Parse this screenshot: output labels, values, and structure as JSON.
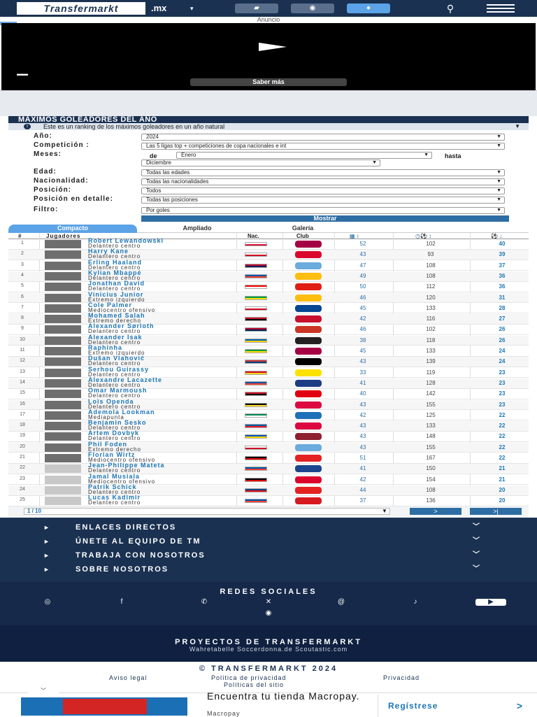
{
  "header": {
    "logo_text": "Transfermarkt",
    "domain": ".mx",
    "nav_icons": [
      "bookmark-icon",
      "ball-icon",
      "user-icon"
    ],
    "colors": {
      "bar": "#1a3151",
      "active": "#5ba3e6"
    }
  },
  "ad": {
    "label": "Anuncio",
    "cta": "Saber más"
  },
  "section": {
    "title": "MÁXIMOS GOLEADORES DEL AÑO",
    "info": "Este es un ranking de los máximos goleadores en un año natural",
    "filters": {
      "year_label": "Año:",
      "year_value": "2024",
      "competition_label": "Competición :",
      "competition_value": "Las 5 ligas top + competiciones de copa nacionales e int",
      "months_label": "Meses:",
      "months_from_prefix": "de",
      "months_from": "Enero",
      "months_to_label": "hasta",
      "months_to": "Diciembre",
      "age_label": "Edad:",
      "age_value": "Todas las edades",
      "nationality_label": "Nacionalidad:",
      "nationality_value": "Todas las nacionalidades",
      "position_label": "Posición:",
      "position_value": "Todos",
      "detail_position_label": "Posición en detalle:",
      "detail_position_value": "Todas las posiciones",
      "filter_label": "Filtro:",
      "filter_value": "Por goles",
      "submit": "Mostrar"
    },
    "tabs": [
      "Compacto",
      "Ampliado",
      "Galería"
    ],
    "columns": {
      "rank": "#",
      "players": "Jugadores",
      "nationality": "Nac.",
      "club": "Club"
    },
    "players": [
      {
        "rank": "1",
        "name": "Robert Lewandowski",
        "position": "Delantero centro",
        "apps": "52",
        "mins": "102",
        "goals": "40",
        "flag": [
          "#fff",
          "#dc143c"
        ],
        "crest": "#a50044"
      },
      {
        "rank": "2",
        "name": "Harry Kane",
        "position": "Delantero centro",
        "apps": "43",
        "mins": "93",
        "goals": "39",
        "flag": [
          "#fff",
          "#ce1124"
        ],
        "crest": "#dc052d"
      },
      {
        "rank": "3",
        "name": "Erling Haaland",
        "position": "Delantero centro",
        "apps": "47",
        "mins": "108",
        "goals": "37",
        "flag": [
          "#ba0c2f",
          "#00205b"
        ],
        "crest": "#6cabdd"
      },
      {
        "rank": "4",
        "name": "Kylian Mbappé",
        "position": "Delantero centro",
        "apps": "49",
        "mins": "108",
        "goals": "36",
        "flag": [
          "#0055a4",
          "#ef4135"
        ],
        "crest": "#febe10"
      },
      {
        "rank": "5",
        "name": "Jonathan David",
        "position": "Delantero centro",
        "apps": "50",
        "mins": "112",
        "goals": "36",
        "flag": [
          "#ff0000",
          "#fff"
        ],
        "crest": "#e01e13"
      },
      {
        "rank": "6",
        "name": "Vinicius Junior",
        "position": "Extremo izquierdo",
        "apps": "46",
        "mins": "120",
        "goals": "31",
        "flag": [
          "#009c3b",
          "#ffdf00"
        ],
        "crest": "#febe10"
      },
      {
        "rank": "7",
        "name": "Cole Palmer",
        "position": "Mediocentro ofensivo",
        "apps": "45",
        "mins": "133",
        "goals": "28",
        "flag": [
          "#fff",
          "#ce1124"
        ],
        "crest": "#034694"
      },
      {
        "rank": "8",
        "name": "Mohamed Salah",
        "position": "Extremo derecho",
        "apps": "42",
        "mins": "116",
        "goals": "27",
        "flag": [
          "#ce1126",
          "#000"
        ],
        "crest": "#c8102e"
      },
      {
        "rank": "9",
        "name": "Alexander Sørloth",
        "position": "Delantero centro",
        "apps": "46",
        "mins": "102",
        "goals": "26",
        "flag": [
          "#ba0c2f",
          "#00205b"
        ],
        "crest": "#cb3524"
      },
      {
        "rank": "10",
        "name": "Alexander Isak",
        "position": "Delantero centro",
        "apps": "38",
        "mins": "118",
        "goals": "26",
        "flag": [
          "#006aa7",
          "#fecc00"
        ],
        "crest": "#241f20"
      },
      {
        "rank": "11",
        "name": "Raphinha",
        "position": "Extremo izquierdo",
        "apps": "45",
        "mins": "133",
        "goals": "24",
        "flag": [
          "#009c3b",
          "#ffdf00"
        ],
        "crest": "#a50044"
      },
      {
        "rank": "12",
        "name": "Dušan Vlahović",
        "position": "Delantero centro",
        "apps": "43",
        "mins": "139",
        "goals": "24",
        "flag": [
          "#c6363c",
          "#0c4076"
        ],
        "crest": "#000000"
      },
      {
        "rank": "13",
        "name": "Serhou Guirassy",
        "position": "Delantero centro",
        "apps": "33",
        "mins": "119",
        "goals": "23",
        "flag": [
          "#ce1126",
          "#fcd116"
        ],
        "crest": "#fde100"
      },
      {
        "rank": "14",
        "name": "Alexandre Lacazette",
        "position": "Delantero centro",
        "apps": "41",
        "mins": "128",
        "goals": "23",
        "flag": [
          "#0055a4",
          "#ef4135"
        ],
        "crest": "#1c3c85"
      },
      {
        "rank": "15",
        "name": "Omar Marmoush",
        "position": "Delantero centro",
        "apps": "40",
        "mins": "142",
        "goals": "23",
        "flag": [
          "#ce1126",
          "#000"
        ],
        "crest": "#e1000f"
      },
      {
        "rank": "16",
        "name": "Loïs Openda",
        "position": "Delantero centro",
        "apps": "43",
        "mins": "155",
        "goals": "23",
        "flag": [
          "#000",
          "#fdda24"
        ],
        "crest": "#dd0741"
      },
      {
        "rank": "17",
        "name": "Ademola Lookman",
        "position": "Mediapunta",
        "apps": "42",
        "mins": "125",
        "goals": "22",
        "flag": [
          "#008751",
          "#fff"
        ],
        "crest": "#1e71b8"
      },
      {
        "rank": "18",
        "name": "Benjamin Sesko",
        "position": "Delantero centro",
        "apps": "43",
        "mins": "133",
        "goals": "22",
        "flag": [
          "#005da4",
          "#ed1c24"
        ],
        "crest": "#dd0741"
      },
      {
        "rank": "19",
        "name": "Artem Dovbyk",
        "position": "Delantero centro",
        "apps": "43",
        "mins": "148",
        "goals": "22",
        "flag": [
          "#0057b7",
          "#ffd700"
        ],
        "crest": "#8e1f2f"
      },
      {
        "rank": "20",
        "name": "Phil Foden",
        "position": "Extremo derecho",
        "apps": "43",
        "mins": "155",
        "goals": "22",
        "flag": [
          "#fff",
          "#ce1124"
        ],
        "crest": "#6cabdd"
      },
      {
        "rank": "21",
        "name": "Florian Wirtz",
        "position": "Mediocentro ofensivo",
        "apps": "51",
        "mins": "167",
        "goals": "22",
        "flag": [
          "#000",
          "#dd0000"
        ],
        "crest": "#e32221"
      },
      {
        "rank": "22",
        "name": "Jean-Philippe Mateta",
        "position": "Delantero centro",
        "apps": "41",
        "mins": "150",
        "goals": "21",
        "flag": [
          "#0055a4",
          "#ef4135"
        ],
        "crest": "#1b458f"
      },
      {
        "rank": "23",
        "name": "Jamal Musiala",
        "position": "Mediocentro ofensivo",
        "apps": "42",
        "mins": "154",
        "goals": "21",
        "flag": [
          "#000",
          "#dd0000"
        ],
        "crest": "#dc052d"
      },
      {
        "rank": "24",
        "name": "Patrik Schick",
        "position": "Delantero centro",
        "apps": "44",
        "mins": "108",
        "goals": "20",
        "flag": [
          "#11457e",
          "#d7141a"
        ],
        "crest": "#e32221"
      },
      {
        "rank": "25",
        "name": "Lucas Kadimir",
        "position": "Delantero centro",
        "apps": "37",
        "mins": "136",
        "goals": "20",
        "flag": [
          "#0055a4",
          "#ef4135"
        ],
        "crest": "#d71920"
      }
    ],
    "pager": {
      "label": "1 / 10",
      "next": ">",
      "last": ">|"
    }
  },
  "footer": {
    "items": [
      "ENLACES DIRECTOS",
      "ÚNETE AL EQUIPO DE TM",
      "TRABAJA CON NOSOTROS",
      "SOBRE NOSOTROS"
    ],
    "social_title": "REDES SOCIALES",
    "social_icons": [
      "instagram-icon",
      "facebook-icon",
      "whatsapp-icon",
      "x-icon",
      "threads-icon",
      "tiktok-icon",
      "youtube-icon",
      "rss-icon"
    ],
    "projects_title": "PROYECTOS DE TRANSFERMARKT",
    "projects_sub": "Wahretabelle Soccerdonna.de Scoutastic.com",
    "copyright": "© TRANSFERMARKT 2024",
    "links": [
      "Aviso legal",
      "Política de privacidad",
      "Privacidad",
      "Políticas del sitio"
    ]
  },
  "bottom_ad": {
    "title": "Encuentra tu tienda Macropay.",
    "sub": "Macropay",
    "cta": "Regístrese"
  }
}
